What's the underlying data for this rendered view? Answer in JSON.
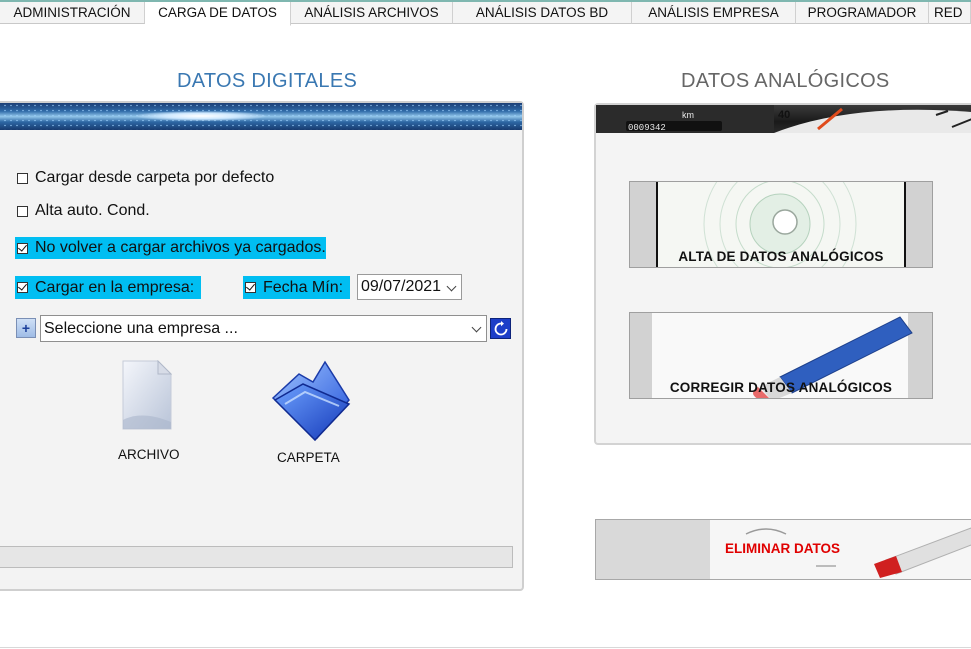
{
  "tabs": [
    {
      "label": "ADMINISTRACIÓN",
      "active": false
    },
    {
      "label": "CARGA DE DATOS",
      "active": true
    },
    {
      "label": "ANÁLISIS ARCHIVOS",
      "active": false
    },
    {
      "label": "ANÁLISIS DATOS BD",
      "active": false
    },
    {
      "label": "ANÁLISIS EMPRESA",
      "active": false
    },
    {
      "label": "PROGRAMADOR",
      "active": false
    },
    {
      "label": "RED",
      "active": false
    }
  ],
  "digital": {
    "title": "DATOS DIGITALES",
    "options": {
      "default_folder": {
        "label": "Cargar desde carpeta por defecto",
        "checked": false
      },
      "auto_driver": {
        "label": "Alta auto. Cond.",
        "checked": false
      },
      "skip_loaded": {
        "label": "No volver a cargar archivos ya cargados.",
        "checked": true
      },
      "load_in_company": {
        "label": "Cargar en la empresa:",
        "checked": true
      },
      "min_date": {
        "label": "Fecha Mín:",
        "checked": true
      }
    },
    "min_date_value": "09/07/2021",
    "company_placeholder": "Seleccione una empresa ...",
    "add_label": "+",
    "file_label": "ARCHIVO",
    "folder_label": "CARPETA"
  },
  "analog": {
    "title": "DATOS ANALÓGICOS",
    "banner_text": {
      "km": "km",
      "speed": "40",
      "odometer": "0009342"
    },
    "add_button": "ALTA DE DATOS ANALÓGICOS",
    "correct_button": "CORREGIR DATOS ANALÓGICOS",
    "delete_button": "ELIMINAR DATOS"
  },
  "colors": {
    "title_digital": "#3a78b2",
    "title_analog": "#666666",
    "highlight": "#00bef2",
    "delete_text": "#e00000"
  }
}
